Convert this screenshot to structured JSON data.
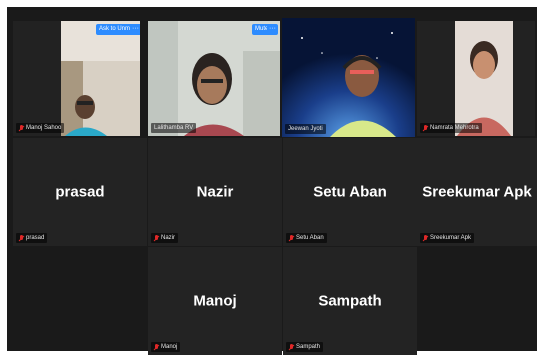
{
  "participants": [
    {
      "id": "manoj-sahoo",
      "display_name": "",
      "label": "Manoj Sahoo",
      "muted": true,
      "video": true,
      "hover_button": "Ask to Unmute",
      "more": "···"
    },
    {
      "id": "lalithamba",
      "display_name": "",
      "label": "Lalithamba RV",
      "muted": false,
      "video": true,
      "hover_button": "Mute",
      "more": "···"
    },
    {
      "id": "jeewan-jyoti",
      "display_name": "",
      "label": "Jeewan Jyoti",
      "muted": false,
      "video": true,
      "active_speaker": true
    },
    {
      "id": "namrata",
      "display_name": "",
      "label": "Namrata Mehrotra",
      "muted": true,
      "video": true
    },
    {
      "id": "prasad",
      "display_name": "prasad",
      "label": "prasad",
      "muted": true,
      "video": false
    },
    {
      "id": "nazir",
      "display_name": "Nazir",
      "label": "Nazir",
      "muted": true,
      "video": false
    },
    {
      "id": "setu-aban",
      "display_name": "Setu Aban",
      "label": "Setu Aban",
      "muted": true,
      "video": false
    },
    {
      "id": "sreekumar",
      "display_name": "Sreekumar Apk",
      "label": "Sreekumar Apk",
      "muted": true,
      "video": false
    },
    {
      "id": "manoj",
      "display_name": "Manoj",
      "label": "Manoj",
      "muted": true,
      "video": false
    },
    {
      "id": "sampath",
      "display_name": "Sampath",
      "label": "Sampath",
      "muted": true,
      "video": false
    }
  ],
  "colors": {
    "active_speaker_border": "#c8d846",
    "accent": "#2d8cff",
    "muted_icon": "#e02828"
  }
}
